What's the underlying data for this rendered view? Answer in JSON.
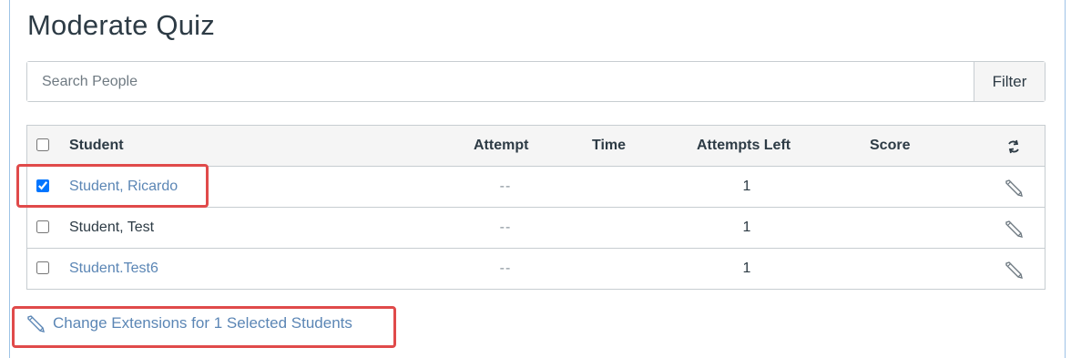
{
  "page": {
    "title": "Moderate Quiz"
  },
  "search": {
    "placeholder": "Search People",
    "filter_label": "Filter"
  },
  "table": {
    "headers": {
      "student": "Student",
      "attempt": "Attempt",
      "time": "Time",
      "attempts_left": "Attempts Left",
      "score": "Score",
      "refresh_icon": "refresh-icon"
    },
    "rows": [
      {
        "student": "Student, Ricardo",
        "attempt": "--",
        "time": "",
        "attempts_left": "1",
        "score": "",
        "checked": true,
        "linked": true,
        "action_icon": "pencil-icon"
      },
      {
        "student": "Student, Test",
        "attempt": "--",
        "time": "",
        "attempts_left": "1",
        "score": "",
        "checked": false,
        "linked": false,
        "action_icon": "pencil-icon"
      },
      {
        "student": "Student.Test6",
        "attempt": "--",
        "time": "",
        "attempts_left": "1",
        "score": "",
        "checked": false,
        "linked": true,
        "action_icon": "pencil-icon"
      }
    ]
  },
  "extensions": {
    "label": "Change Extensions for 1 Selected Students",
    "icon": "pencil-icon"
  },
  "colors": {
    "link": "#5b86b5",
    "highlight": "#e04a4a",
    "text": "#2d3b45"
  }
}
